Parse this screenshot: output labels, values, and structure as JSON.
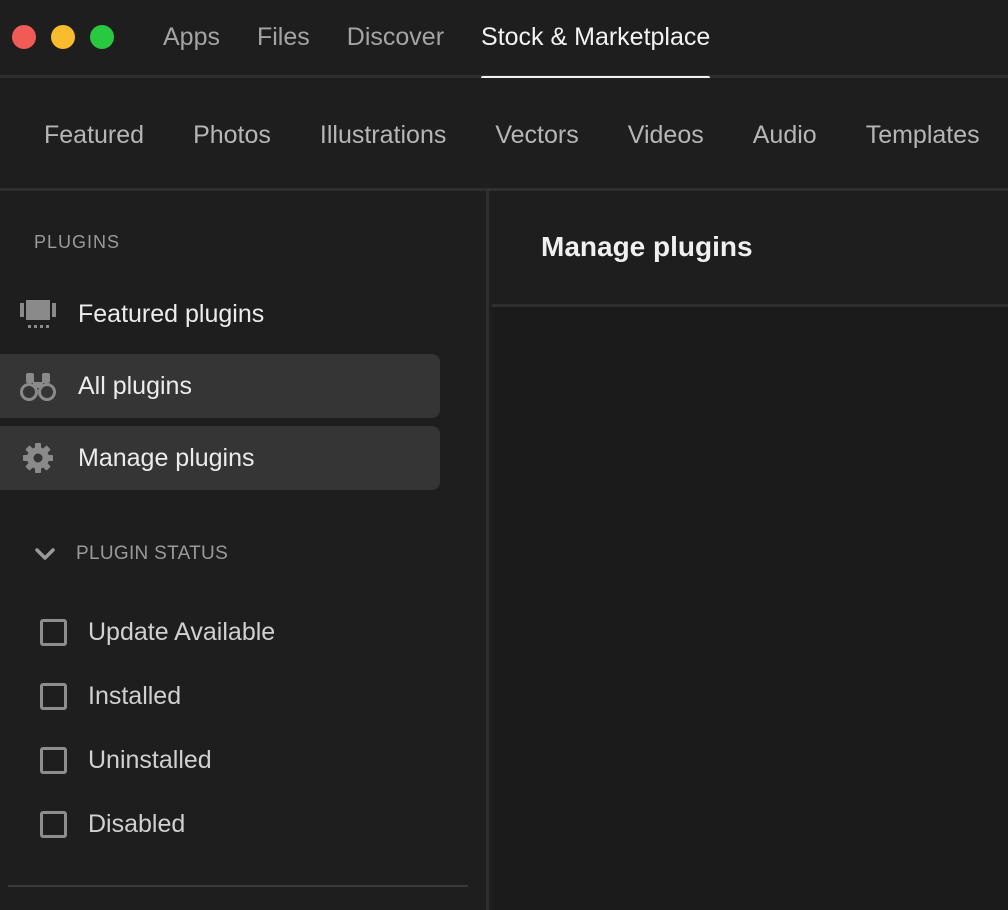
{
  "window": {
    "controls": [
      "close",
      "minimize",
      "maximize"
    ],
    "colors": {
      "close": "#f15b56",
      "minimize": "#f9bc2f",
      "maximize": "#28c840"
    }
  },
  "main_tabs": [
    {
      "label": "Apps",
      "active": false
    },
    {
      "label": "Files",
      "active": false
    },
    {
      "label": "Discover",
      "active": false
    },
    {
      "label": "Stock & Marketplace",
      "active": true
    }
  ],
  "category_tabs": [
    "Featured",
    "Photos",
    "Illustrations",
    "Vectors",
    "Videos",
    "Audio",
    "Templates"
  ],
  "sidebar": {
    "section_heading": "PLUGINS",
    "items": [
      {
        "label": "Featured plugins",
        "icon": "featured-plugins-icon",
        "highlighted": false
      },
      {
        "label": "All plugins",
        "icon": "binoculars-icon",
        "highlighted": true
      },
      {
        "label": "Manage plugins",
        "icon": "gear-icon",
        "highlighted": true
      }
    ],
    "status_group": {
      "label": "PLUGIN STATUS",
      "expanded": true,
      "options": [
        {
          "label": "Update Available",
          "checked": false
        },
        {
          "label": "Installed",
          "checked": false
        },
        {
          "label": "Uninstalled",
          "checked": false
        },
        {
          "label": "Disabled",
          "checked": false
        }
      ]
    }
  },
  "content": {
    "title": "Manage plugins"
  },
  "theme": {
    "background": "#1e1e1e",
    "highlight": "#353535",
    "active_text": "#f2f2f2",
    "muted_text": "#a4a4a4"
  }
}
